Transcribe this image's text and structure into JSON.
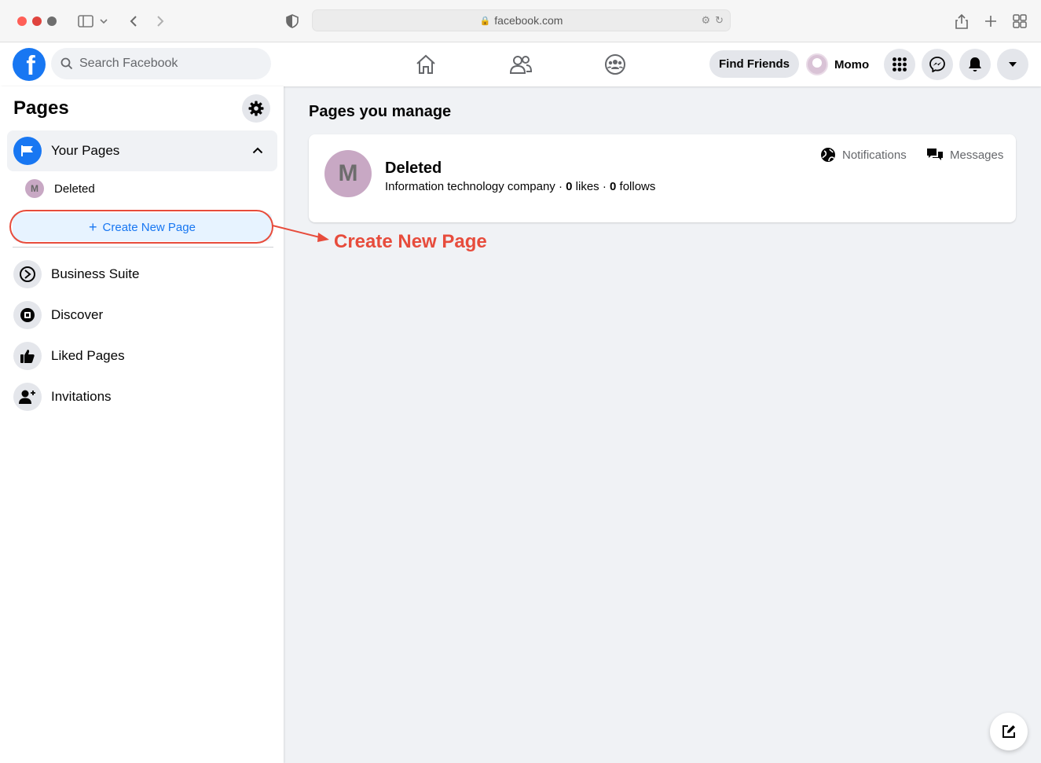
{
  "browser": {
    "url": "facebook.com"
  },
  "topbar": {
    "search_placeholder": "Search Facebook",
    "find_friends_label": "Find Friends",
    "profile_name": "Momo",
    "nav_icons": [
      "home-icon",
      "friends-icon",
      "groups-icon"
    ]
  },
  "sidebar": {
    "title": "Pages",
    "your_pages_label": "Your Pages",
    "pages": [
      {
        "initial": "M",
        "name": "Deleted"
      }
    ],
    "create_label": "Create New Page",
    "items": [
      {
        "label": "Business Suite",
        "icon": "business-suite-icon"
      },
      {
        "label": "Discover",
        "icon": "discover-icon"
      },
      {
        "label": "Liked Pages",
        "icon": "thumbs-up-icon"
      },
      {
        "label": "Invitations",
        "icon": "person-add-icon"
      }
    ]
  },
  "main": {
    "title": "Pages you manage",
    "page_card": {
      "initial": "M",
      "name": "Deleted",
      "category": "Information technology company",
      "separator": " · ",
      "likes_count": "0",
      "likes_word": " likes",
      "follows_count": "0",
      "follows_word": " follows",
      "notifications_label": "Notifications",
      "messages_label": "Messages"
    }
  },
  "annotation": {
    "text": "Create New Page",
    "color": "#e74c3c"
  },
  "colors": {
    "brand": "#1877f2",
    "annotation": "#e74c3c"
  }
}
